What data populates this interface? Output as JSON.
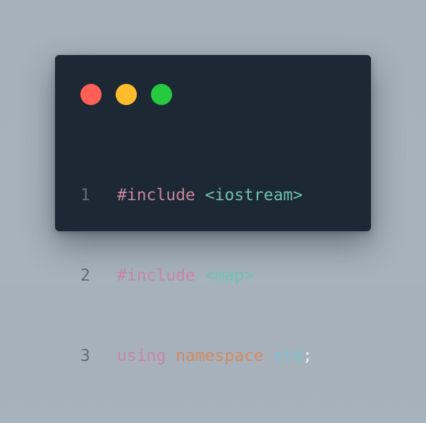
{
  "colors": {
    "close": "#ff5f56",
    "minimize": "#ffbd2e",
    "maximize": "#27c93f",
    "background": "#1c2833",
    "keyword": "#c7869f",
    "library": "#6ec3ac",
    "namespace": "#cf8a63",
    "identifier": "#7cc3d1",
    "line_number": "#5f6b75"
  },
  "window_controls": [
    {
      "name": "close",
      "icon": "red-circle"
    },
    {
      "name": "minimize",
      "icon": "yellow-circle"
    },
    {
      "name": "maximize",
      "icon": "green-circle"
    }
  ],
  "code": {
    "lines": [
      {
        "number": "1",
        "tokens": [
          "#include",
          " ",
          "<iostream>"
        ]
      },
      {
        "number": "2",
        "tokens": [
          "#include",
          " ",
          "<map>"
        ]
      },
      {
        "number": "3",
        "tokens": [
          "using",
          " ",
          "namespace",
          " ",
          "std",
          ";"
        ]
      }
    ]
  }
}
